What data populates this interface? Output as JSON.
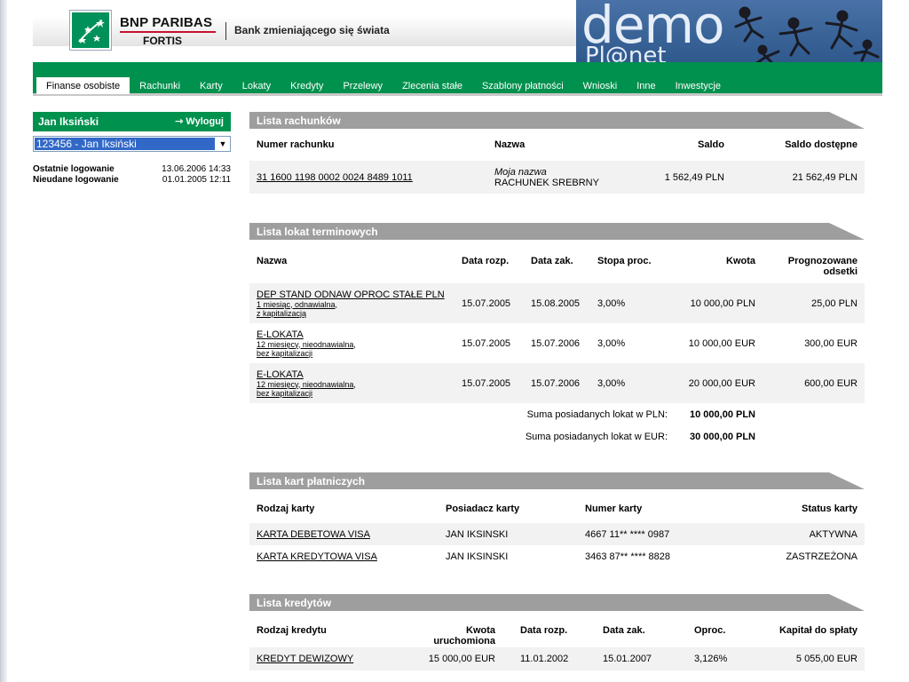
{
  "header": {
    "brand_line1": "BNP PARIBAS",
    "brand_line2": "FORTIS",
    "slogan": "Bank zmieniającego się świata",
    "banner_line1": "demo",
    "banner_line2": "Pl@net"
  },
  "colors": {
    "brand_green": "#00914e",
    "section_gray": "#9e9e9e",
    "select_blue": "#3168c7"
  },
  "nav": {
    "items": [
      {
        "label": "Finanse osobiste",
        "active": true
      },
      {
        "label": "Rachunki"
      },
      {
        "label": "Karty"
      },
      {
        "label": "Lokaty"
      },
      {
        "label": "Kredyty"
      },
      {
        "label": "Przelewy"
      },
      {
        "label": "Zlecenia stałe"
      },
      {
        "label": "Szablony płatności"
      },
      {
        "label": "Wnioski"
      },
      {
        "label": "Inne"
      },
      {
        "label": "Inwestycje"
      }
    ]
  },
  "user": {
    "name": "Jan Iksiński",
    "logout_label": "Wyloguj",
    "account_selected": "123456 - Jan Iksiński",
    "last_login_label": "Ostatnie logowanie",
    "last_login_value": "13.06.2006 14:33",
    "failed_login_label": "Nieudane logowanie",
    "failed_login_value": "01.01.2005 12:11"
  },
  "accounts": {
    "title": "Lista rachunków",
    "headers": [
      "Numer rachunku",
      "Nazwa",
      "Saldo",
      "Saldo dostępne"
    ],
    "rows": [
      {
        "number": "31 1600 1198 0002 0024 8489 1011",
        "custom_name": "Moja nazwa",
        "name": "RACHUNEK SREBRNY",
        "balance": "1 562,49 PLN",
        "available": "21 562,49 PLN"
      }
    ]
  },
  "deposits": {
    "title": "Lista lokat terminowych",
    "headers": [
      "Nazwa",
      "Data rozp.",
      "Data zak.",
      "Stopa proc.",
      "Kwota",
      "Prognozowane odsetki"
    ],
    "rows": [
      {
        "name": "DEP STAND ODNAW OPROC STAŁE PLN",
        "detail1": "1 miesiąc, odnawialna,",
        "detail2": "z kapitalizacją",
        "start": "15.07.2005",
        "end": "15.08.2005",
        "rate": "3,00%",
        "amount": "10 000,00 PLN",
        "interest": "25,00 PLN"
      },
      {
        "name": "E-LOKATA",
        "detail1": "12 miesięcy, nieodnawialna,",
        "detail2": "bez kapitalizacji",
        "start": "15.07.2005",
        "end": "15.07.2006",
        "rate": "3,00%",
        "amount": "10 000,00 EUR",
        "interest": "300,00 EUR"
      },
      {
        "name": "E-LOKATA",
        "detail1": "12 miesięcy, nieodnawialna,",
        "detail2": "bez kapitalizacji",
        "start": "15.07.2005",
        "end": "15.07.2006",
        "rate": "3,00%",
        "amount": "20 000,00 EUR",
        "interest": "600,00 EUR"
      }
    ],
    "sum_pln_label": "Suma posiadanych lokat w PLN:",
    "sum_pln_value": "10 000,00 PLN",
    "sum_eur_label": "Suma posiadanych lokat w EUR:",
    "sum_eur_value": "30 000,00 PLN"
  },
  "cards": {
    "title": "Lista kart płatniczych",
    "headers": [
      "Rodzaj karty",
      "Posiadacz karty",
      "Numer karty",
      "Status karty"
    ],
    "rows": [
      {
        "type": "KARTA DEBETOWA VISA",
        "holder": "JAN IKSINSKI",
        "number": "4667 11** **** 0987",
        "status": "AKTYWNA"
      },
      {
        "type": "KARTA KREDYTOWA VISA",
        "holder": "JAN IKSINSKI",
        "number": "3463 87** **** 8828",
        "status": "ZASTRZEŻONA"
      }
    ]
  },
  "loans": {
    "title": "Lista kredytów",
    "headers": [
      "Rodzaj kredytu",
      "Kwota uruchomiona",
      "Data rozp.",
      "Data zak.",
      "Oproc.",
      "Kapitał do spłaty"
    ],
    "rows": [
      {
        "type": "KREDYT DEWIZOWY",
        "amount": "15 000,00 EUR",
        "start": "11.01.2002",
        "end": "15.01.2007",
        "rate": "3,126%",
        "capital": "5 055,00 EUR"
      }
    ]
  }
}
